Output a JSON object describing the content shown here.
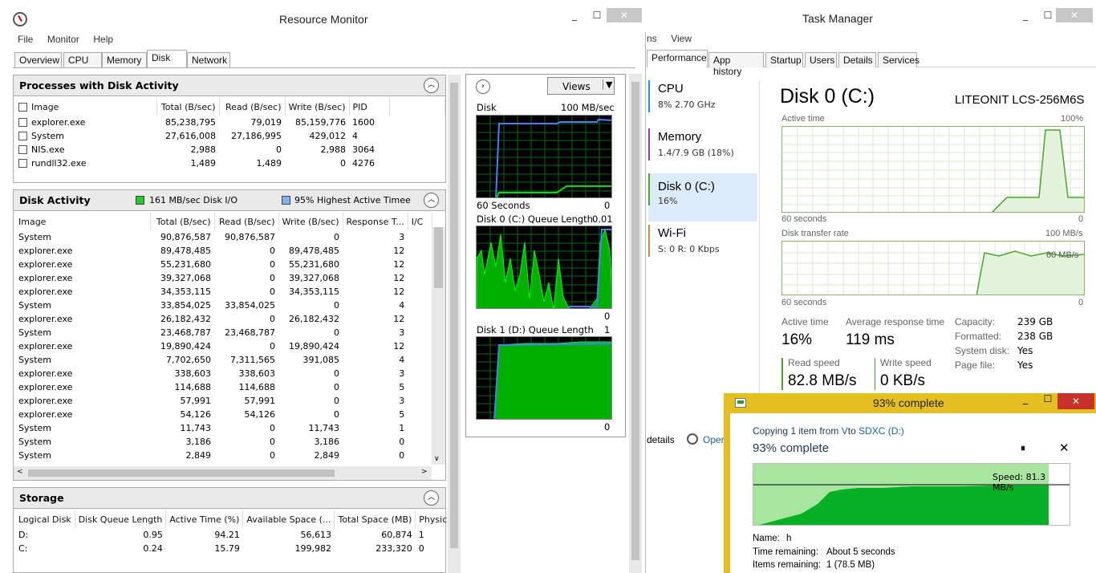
{
  "resmon": {
    "title": "Resource Monitor",
    "menu": [
      "File",
      "Monitor",
      "Help"
    ],
    "tabs": [
      "Overview",
      "CPU",
      "Memory",
      "Disk",
      "Network"
    ],
    "processes": {
      "title": "Processes with Disk Activity",
      "headers": [
        "Image",
        "Total (B/sec)",
        "Read (B/sec)",
        "Write (B/sec)",
        "PID"
      ],
      "rows": [
        [
          "explorer.exe",
          "85,238,795",
          "79,019",
          "85,159,776",
          "1600"
        ],
        [
          "System",
          "27,616,008",
          "27,186,995",
          "429,012",
          "4"
        ],
        [
          "NIS.exe",
          "2,988",
          "0",
          "2,988",
          "3064"
        ],
        [
          "rundll32.exe",
          "1,489",
          "1,489",
          "0",
          "4276"
        ]
      ]
    },
    "disk_activity": {
      "title": "Disk Activity",
      "io_label": "161 MB/sec Disk I/O",
      "active_label": "95% Highest Active Timee",
      "headers": [
        "Image",
        "Total (B/sec)",
        "Read (B/sec)",
        "Write (B/sec)",
        "Response T...",
        "I/C"
      ],
      "rows": [
        [
          "System",
          "90,876,587",
          "90,876,587",
          "0",
          "3"
        ],
        [
          "explorer.exe",
          "89,478,485",
          "0",
          "89,478,485",
          "12"
        ],
        [
          "explorer.exe",
          "55,231,680",
          "0",
          "55,231,680",
          "12"
        ],
        [
          "explorer.exe",
          "39,327,068",
          "0",
          "39,327,068",
          "12"
        ],
        [
          "explorer.exe",
          "34,353,115",
          "0",
          "34,353,115",
          "12"
        ],
        [
          "System",
          "33,854,025",
          "33,854,025",
          "0",
          "4"
        ],
        [
          "explorer.exe",
          "26,182,432",
          "0",
          "26,182,432",
          "12"
        ],
        [
          "System",
          "23,468,787",
          "23,468,787",
          "0",
          "3"
        ],
        [
          "explorer.exe",
          "19,890,424",
          "0",
          "19,890,424",
          "12"
        ],
        [
          "System",
          "7,702,650",
          "7,311,565",
          "391,085",
          "4"
        ],
        [
          "explorer.exe",
          "338,603",
          "338,603",
          "0",
          "3"
        ],
        [
          "explorer.exe",
          "114,688",
          "114,688",
          "0",
          "5"
        ],
        [
          "explorer.exe",
          "57,991",
          "57,991",
          "0",
          "3"
        ],
        [
          "explorer.exe",
          "54,126",
          "54,126",
          "0",
          "5"
        ],
        [
          "System",
          "11,743",
          "0",
          "11,743",
          "1"
        ],
        [
          "System",
          "3,186",
          "0",
          "3,186",
          "0"
        ],
        [
          "System",
          "2,849",
          "0",
          "2,849",
          "0"
        ]
      ]
    },
    "storage": {
      "title": "Storage",
      "headers": [
        "Logical Disk",
        "Disk Queue Length",
        "Active Time (%)",
        "Available Space (...",
        "Total Space (MB)",
        "Physical"
      ],
      "rows": [
        [
          "D:",
          "0.95",
          "94.21",
          "56,613",
          "60,874",
          "1"
        ],
        [
          "C:",
          "0.24",
          "15.79",
          "199,982",
          "233,320",
          "0"
        ]
      ]
    },
    "graphs": {
      "views_label": "Views",
      "disk_label": "Disk",
      "disk_max": "100 MB/sec",
      "seconds": "60 Seconds",
      "zero": "0",
      "q0_label": "Disk 0 (C:) Queue Length",
      "q0_max": "0.01",
      "q1_label": "Disk 1 (D:) Queue Length",
      "q1_max": "1"
    }
  },
  "taskmgr": {
    "title": "Task Manager",
    "menu": [
      "ns",
      "View"
    ],
    "tabs": [
      "Performance",
      "App history",
      "Startup",
      "Users",
      "Details",
      "Services"
    ],
    "sidebar": [
      {
        "name": "CPU",
        "sub": "8% 2.70 GHz"
      },
      {
        "name": "Memory",
        "sub": "1.4/7.9 GB (18%)"
      },
      {
        "name": "Disk 0 (C:)",
        "sub": "16%"
      },
      {
        "name": "Wi-Fi",
        "sub": "S: 0 R: 0 Kbps"
      }
    ],
    "disk_title": "Disk 0 (C:)",
    "model": "LITEONIT LCS-256M6S",
    "active_time_label": "Active time",
    "active_max": "100%",
    "seconds": "60 seconds",
    "zero": "0",
    "transfer_label": "Disk transfer rate",
    "transfer_max": "100 MB/s",
    "transfer_mid": "60 MB/s",
    "stats": {
      "active_time_label": "Active time",
      "active_time": "16%",
      "resp_label": "Average response time",
      "resp": "119 ms",
      "read_label": "Read speed",
      "read": "82.8 MB/s",
      "write_label": "Write speed",
      "write": "0 KB/s",
      "capacity_label": "Capacity:",
      "capacity": "239 GB",
      "formatted_label": "Formatted:",
      "formatted": "238 GB",
      "sysdisk_label": "System disk:",
      "sysdisk": "Yes",
      "pagefile_label": "Page file:",
      "pagefile": "Yes"
    },
    "footer_details": "details",
    "footer_open": "Oper"
  },
  "copy": {
    "title": "93% complete",
    "copying_prefix": "Copying 1 item from ",
    "source": "V",
    "to": "to ",
    "dest": "SDXC (D:)",
    "percent_text": "93% complete",
    "progress": 0.93,
    "speed": "Speed: 81.3 MB/s",
    "name_label": "Name:",
    "name": "h",
    "remaining_label": "Time remaining:",
    "remaining": "About 5 seconds",
    "items_label": "Items remaining:",
    "items": "1 (78.5 MB)"
  },
  "colors": {
    "green_graph": "#00c000",
    "blue_line": "#4a7cff",
    "tm_green": "#4da52e",
    "copy_border": "#e3c020",
    "copy_fill": "#06b025"
  }
}
